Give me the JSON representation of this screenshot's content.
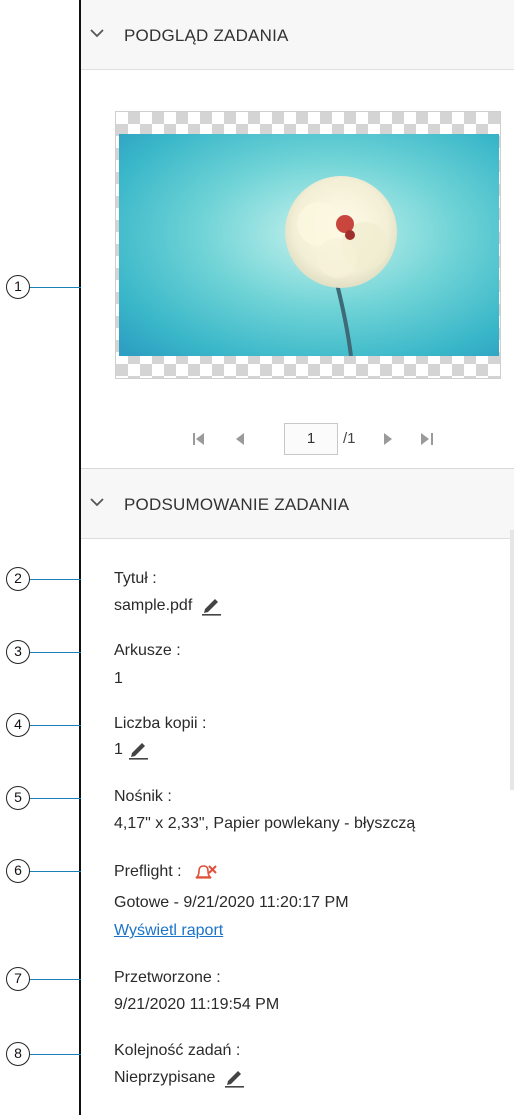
{
  "callouts": [
    "1",
    "2",
    "3",
    "4",
    "5",
    "6",
    "7",
    "8"
  ],
  "preview_section": {
    "title": "PODGLĄD ZADANIA"
  },
  "pager": {
    "current_page": "1",
    "total": "/1"
  },
  "summary_section": {
    "title": "PODSUMOWANIE ZADANIA",
    "title_field": {
      "label": "Tytuł :",
      "value": "sample.pdf"
    },
    "sheets_field": {
      "label": "Arkusze :",
      "value": "1"
    },
    "copies_field": {
      "label": "Liczba kopii :",
      "value": "1"
    },
    "media_field": {
      "label": "Nośnik :",
      "value": "4,17\" x 2,33\", Papier powlekany - błyszczą"
    },
    "preflight_field": {
      "label": "Preflight :",
      "value": "Gotowe - 9/21/2020 11:20:17 PM",
      "link": "Wyświetl raport"
    },
    "processed_field": {
      "label": "Przetworzone :",
      "value": "9/21/2020 11:19:54 PM"
    },
    "job_order_field": {
      "label": "Kolejność zadań :",
      "value": "Nieprzypisane"
    }
  },
  "colors": {
    "leader": "#1b7fb8",
    "link": "#1a73c9",
    "alert": "#e0503a"
  },
  "icons": [
    "chevron-down-icon",
    "first-page-icon",
    "previous-page-icon",
    "next-page-icon",
    "last-page-icon",
    "pencil-edit-icon",
    "preflight-error-bell-icon"
  ]
}
